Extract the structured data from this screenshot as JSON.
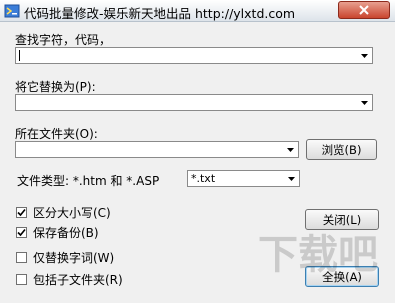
{
  "window": {
    "title": "代码批量修改-娱乐新天地出品 http://ylxtd.com",
    "close_icon": "close-icon"
  },
  "search": {
    "label": "查找字符，代码，",
    "value": ""
  },
  "replace": {
    "label": "将它替换为(P):",
    "value": ""
  },
  "folder": {
    "label": "所在文件夹(O):",
    "value": "",
    "browse_label": "浏览(B)"
  },
  "filetype": {
    "label": "文件类型: *.htm 和 *.ASP",
    "selected": "*.txt"
  },
  "options": [
    {
      "label": "区分大小写(C)",
      "checked": true
    },
    {
      "label": "保存备份(B)",
      "checked": true
    },
    {
      "label": "仅替换字词(W)",
      "checked": false
    },
    {
      "label": "包括子文件夹(R)",
      "checked": false
    }
  ],
  "buttons": {
    "close_label": "关闭(L)",
    "replace_all_label": "全换(A)"
  },
  "watermark": {
    "text": "下载吧"
  },
  "colors": {
    "titlebar_close": "#c9452e",
    "default_button_border": "#3c7fb1"
  }
}
